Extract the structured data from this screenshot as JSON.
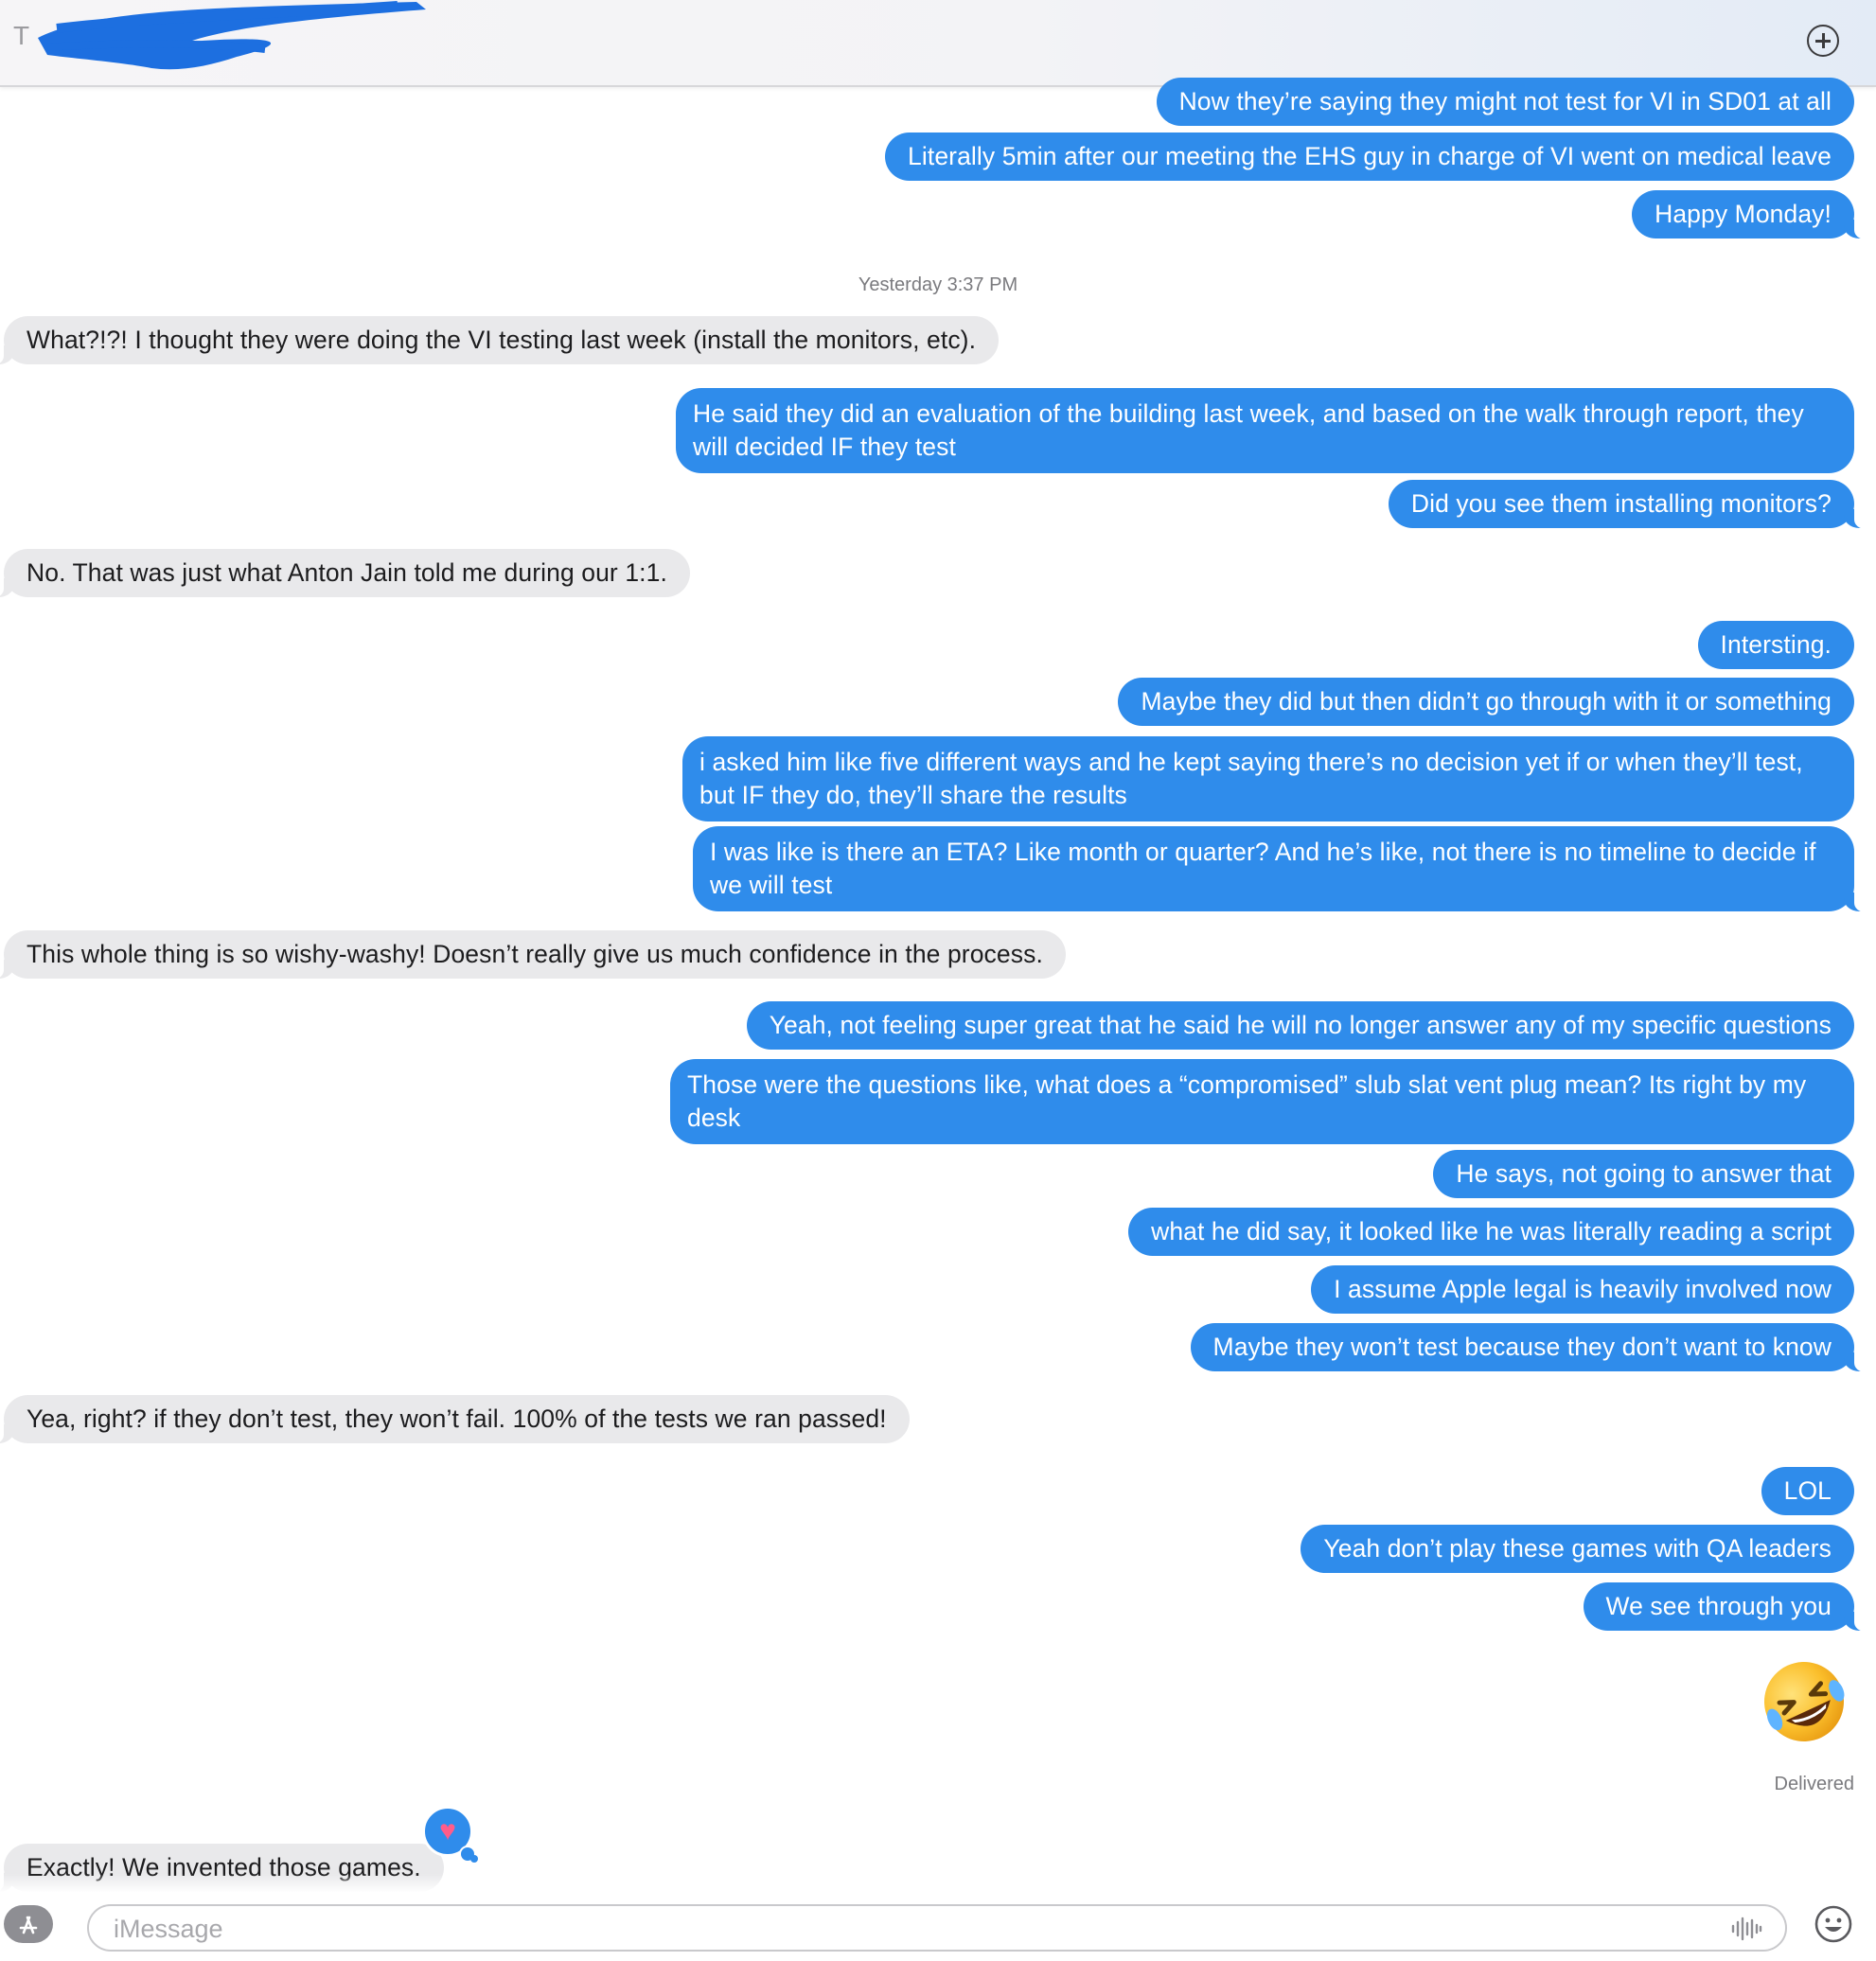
{
  "header": {
    "to_label": "T"
  },
  "messages": [
    {
      "dir": "out",
      "text": "Now they’re saying they might not test for VI in SD01 at all"
    },
    {
      "dir": "out",
      "text": "Literally 5min after our meeting the EHS guy in charge of VI went on medical leave"
    },
    {
      "dir": "out",
      "text": "Happy Monday!"
    },
    {
      "dir": "in",
      "text": "What?!?! I thought they were doing the VI testing last week (install the monitors, etc)."
    },
    {
      "dir": "out",
      "text": "He said they did an evaluation of the building last week, and based on the walk through report, they will decided IF they test"
    },
    {
      "dir": "out",
      "text": "Did you see them installing monitors?"
    },
    {
      "dir": "in",
      "text": "No. That was just what Anton Jain told me during our 1:1."
    },
    {
      "dir": "out",
      "text": "Intersting."
    },
    {
      "dir": "out",
      "text": "Maybe they did but then didn’t go through with it or something"
    },
    {
      "dir": "out",
      "text": "i asked him like five different ways and he kept saying there’s no decision yet if or when they’ll test, but IF they do, they’ll share the results"
    },
    {
      "dir": "out",
      "text": "I was like is there an ETA? Like month or quarter? And he’s like, not there is no timeline to decide if we will test"
    },
    {
      "dir": "in",
      "text": "This whole thing is so wishy-washy! Doesn’t really give us much confidence in the process."
    },
    {
      "dir": "out",
      "text": "Yeah, not feeling super great that he said he will no longer answer any of my specific questions"
    },
    {
      "dir": "out",
      "text": "Those were the questions like, what does a “compromised” slub slat vent plug mean? Its right by my desk"
    },
    {
      "dir": "out",
      "text": "He says, not going to answer that"
    },
    {
      "dir": "out",
      "text": "what he did say, it looked like he was literally reading a script"
    },
    {
      "dir": "out",
      "text": "I assume Apple legal is heavily involved now"
    },
    {
      "dir": "out",
      "text": "Maybe they won’t test because they don’t want to know"
    },
    {
      "dir": "in",
      "text": "Yea, right? if they don’t test, they won’t fail. 100% of the tests we ran passed!"
    },
    {
      "dir": "out",
      "text": "LOL"
    },
    {
      "dir": "out",
      "text": "Yeah don’t play these games with QA leaders"
    },
    {
      "dir": "out",
      "text": "We see through you"
    },
    {
      "dir": "out",
      "text": "🤣",
      "emoji": "rolling-on-floor-laughing"
    },
    {
      "dir": "in",
      "text": "Exactly! We invented those games.",
      "tapback": "heart"
    }
  ],
  "timestamp": "Yesterday 3:37 PM",
  "status": "Delivered",
  "composer": {
    "placeholder": "iMessage"
  },
  "colors": {
    "outgoing": "#2f8ceb",
    "incoming": "#e9e9eb",
    "tapback_heart": "#ff5c8a"
  }
}
